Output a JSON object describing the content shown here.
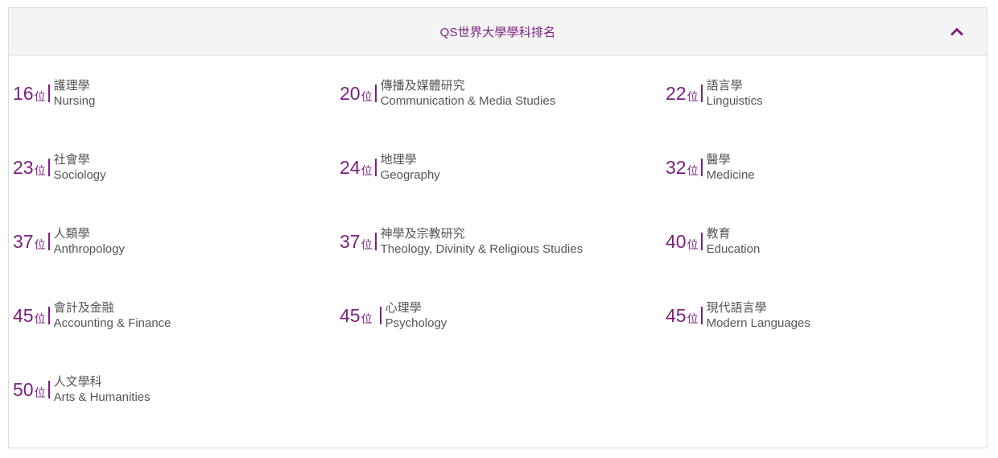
{
  "header": {
    "title": "QS世界大學學科排名",
    "toggle_icon": "chevron-up-icon"
  },
  "colors": {
    "accent": "#7a1f7f",
    "text": "#555555",
    "header_bg": "#f4f4f4",
    "border": "#dcdcdc"
  },
  "rankings": [
    {
      "rank": "16",
      "suffix": "位",
      "zh": "護理學",
      "en": "Nursing"
    },
    {
      "rank": "20",
      "suffix": "位",
      "zh": "傳播及媒體研究",
      "en": "Communication & Media Studies"
    },
    {
      "rank": "22",
      "suffix": "位",
      "zh": "語言學",
      "en": "Linguistics"
    },
    {
      "rank": "23",
      "suffix": "位",
      "zh": "社會學",
      "en": "Sociology"
    },
    {
      "rank": "24",
      "suffix": "位",
      "zh": "地理學",
      "en": "Geography"
    },
    {
      "rank": "32",
      "suffix": "位",
      "zh": "醫學",
      "en": "Medicine"
    },
    {
      "rank": "37",
      "suffix": "位",
      "zh": "人類學",
      "en": "Anthropology"
    },
    {
      "rank": "37",
      "suffix": "位",
      "zh": "神學及宗教研究",
      "en": "Theology, Divinity & Religious Studies"
    },
    {
      "rank": "40",
      "suffix": "位",
      "zh": "教育",
      "en": "Education"
    },
    {
      "rank": "45",
      "suffix": "位",
      "zh": "會計及金融",
      "en": "Accounting & Finance"
    },
    {
      "rank": "45",
      "suffix": "位",
      "zh": "心理學",
      "en": "Psychology"
    },
    {
      "rank": "45",
      "suffix": "位",
      "zh": "現代語言學",
      "en": "Modern Languages"
    },
    {
      "rank": "50",
      "suffix": "位",
      "zh": "人文學科",
      "en": "Arts & Humanities"
    }
  ]
}
